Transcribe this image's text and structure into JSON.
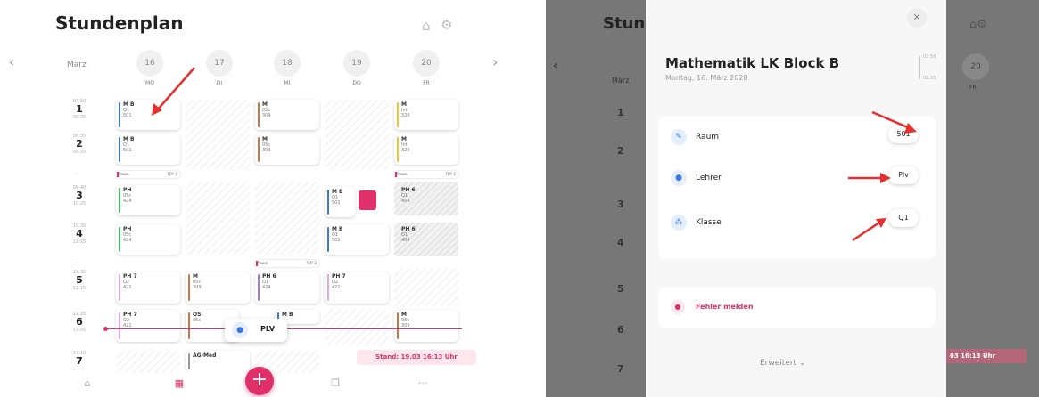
{
  "left": {
    "title": "Stundenplan",
    "month": "März",
    "days": [
      {
        "num": "16",
        "name": "MO"
      },
      {
        "num": "17",
        "name": "DI"
      },
      {
        "num": "18",
        "name": "MI"
      },
      {
        "num": "19",
        "name": "DO"
      },
      {
        "num": "20",
        "name": "FR"
      }
    ],
    "periods": [
      {
        "start": "07:50",
        "num": "1",
        "end": "08:35"
      },
      {
        "start": "08:35",
        "num": "2",
        "end": "09:20"
      },
      {
        "start": "09:40",
        "num": "3",
        "end": "10:25"
      },
      {
        "start": "10:30",
        "num": "4",
        "end": "11:15"
      },
      {
        "start": "11:30",
        "num": "5",
        "end": "12:15"
      },
      {
        "start": "12:20",
        "num": "6",
        "end": "13:05"
      },
      {
        "start": "13:10",
        "num": "7",
        "end": ""
      }
    ],
    "cards": {
      "mo1": {
        "s": "M B",
        "a": "Q1",
        "b": "501"
      },
      "mo2": {
        "s": "M B",
        "a": "Q1",
        "b": "501"
      },
      "mo3": {
        "s": "PH",
        "a": "05c",
        "b": "424"
      },
      "mo4": {
        "s": "PH",
        "a": "05c",
        "b": "424"
      },
      "mo5": {
        "s": "PH 7",
        "a": "Q2",
        "b": "421"
      },
      "mo6": {
        "s": "PH 7",
        "a": "Q2",
        "b": "421"
      },
      "di5": {
        "s": "M",
        "a": "05c",
        "b": "309"
      },
      "di6": {
        "s": "OS",
        "a": "05c",
        "b": ""
      },
      "di7": {
        "s": "AG-Med",
        "a": "",
        "b": ""
      },
      "mi1": {
        "s": "M",
        "a": "05c",
        "b": "309"
      },
      "mi2": {
        "s": "M",
        "a": "05c",
        "b": "309"
      },
      "mi5": {
        "s": "PH 6",
        "a": "Q1",
        "b": "424"
      },
      "mi6": {
        "s": "M B",
        "a": "",
        "b": ""
      },
      "do3": {
        "s": "M B",
        "a": "Q1",
        "b": "501"
      },
      "do4": {
        "s": "M B",
        "a": "Q1",
        "b": "501"
      },
      "do5": {
        "s": "PH 7",
        "a": "Q2",
        "b": "421"
      },
      "fr1": {
        "s": "M",
        "a": "Int",
        "b": "320"
      },
      "fr2": {
        "s": "M",
        "a": "Int",
        "b": "320"
      },
      "fr3": {
        "s": "PH 6",
        "a": "Q1",
        "b": "404"
      },
      "fr4": {
        "s": "PH 6",
        "a": "Q1",
        "b": "404"
      },
      "fr6": {
        "s": "M",
        "a": "05c",
        "b": "309"
      }
    },
    "pause": {
      "label": "Pause",
      "tag1": "FOY 2",
      "tag2": "FOY 1",
      "tag3": "FOY 2"
    },
    "dash": "-",
    "plv": "PLV",
    "stand": "Stand: 19.03 16:13 Uhr",
    "fab": "+"
  },
  "right": {
    "title_partial": "Stun",
    "month": "März",
    "day_num": "20",
    "day_name": "FR",
    "modal": {
      "title": "Mathematik LK Block B",
      "subtitle": "Montag, 16. März 2020",
      "time_start": "07:50",
      "time_end": "08:35",
      "rows": [
        {
          "label": "Raum",
          "value": "501"
        },
        {
          "label": "Lehrer",
          "value": "Plv"
        },
        {
          "label": "Klasse",
          "value": "Q1"
        }
      ],
      "error": "Fehler melden",
      "more": "Erweitert"
    },
    "stand_partial": "03 16:13 Uhr"
  },
  "colors": {
    "accent": "#e0306a",
    "blue": "#3a78e0"
  }
}
